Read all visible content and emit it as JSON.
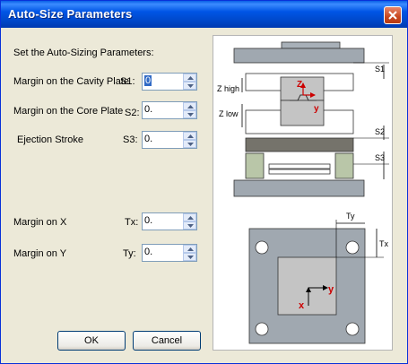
{
  "window": {
    "title": "Auto-Size Parameters"
  },
  "form": {
    "heading": "Set the Auto-Sizing Parameters:",
    "fields": [
      {
        "label": "Margin on the Cavity Plate",
        "code": "S1:",
        "value": "0"
      },
      {
        "label": "Margin on the Core Plate",
        "code": "S2:",
        "value": "0."
      },
      {
        "label": "Ejection Stroke",
        "code": "S3:",
        "value": "0."
      },
      {
        "label": "Margin on X",
        "code": "Tx:",
        "value": "0."
      },
      {
        "label": "Margin on Y",
        "code": "Ty:",
        "value": "0."
      }
    ]
  },
  "buttons": {
    "ok": "OK",
    "cancel": "Cancel"
  },
  "diagram": {
    "side_labels": {
      "s1": "S1",
      "s2": "S2",
      "s3": "S3",
      "z_high": "Z high",
      "z_low": "Z low",
      "z_axis": "Z",
      "y_axis": "y"
    },
    "plan_labels": {
      "ty": "Ty",
      "tx": "Tx",
      "x_axis": "x",
      "y_axis": "y"
    },
    "colors": {
      "axis": "#cc0000",
      "plate": "#a0a8b0",
      "insert": "#c4c4c4",
      "ejector": "#b9c6a8",
      "dark_plate": "#75736b"
    }
  }
}
